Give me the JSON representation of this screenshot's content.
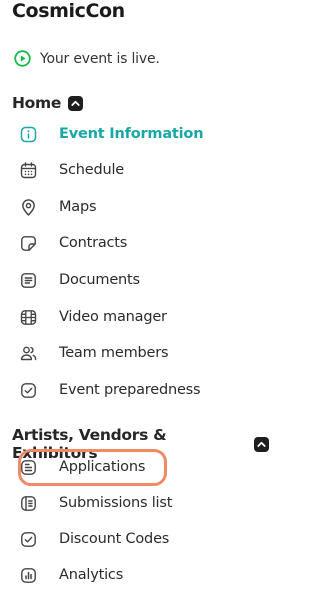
{
  "app": {
    "title": "CosmicCon"
  },
  "status": {
    "text": "Your event is live.",
    "icon": "play-circle-icon",
    "color": "#19b94a"
  },
  "colors": {
    "accent": "#1aa8a6",
    "highlight": "#ef8a66"
  },
  "sections": [
    {
      "title": "Home",
      "expanded": true,
      "items": [
        {
          "label": "Event Information",
          "icon": "info-icon",
          "active": true
        },
        {
          "label": "Schedule",
          "icon": "calendar-icon"
        },
        {
          "label": "Maps",
          "icon": "map-pin-icon"
        },
        {
          "label": "Contracts",
          "icon": "contract-icon"
        },
        {
          "label": "Documents",
          "icon": "document-icon"
        },
        {
          "label": "Video manager",
          "icon": "video-icon"
        },
        {
          "label": "Team members",
          "icon": "team-icon"
        },
        {
          "label": "Event preparedness",
          "icon": "check-icon"
        }
      ]
    },
    {
      "title": "Artists, Vendors & Exhibitors",
      "expanded": true,
      "items": [
        {
          "label": "Applications",
          "icon": "application-icon",
          "highlighted": true
        },
        {
          "label": "Submissions list",
          "icon": "submissions-icon"
        },
        {
          "label": "Discount Codes",
          "icon": "check-icon"
        },
        {
          "label": "Analytics",
          "icon": "analytics-icon"
        }
      ]
    }
  ]
}
